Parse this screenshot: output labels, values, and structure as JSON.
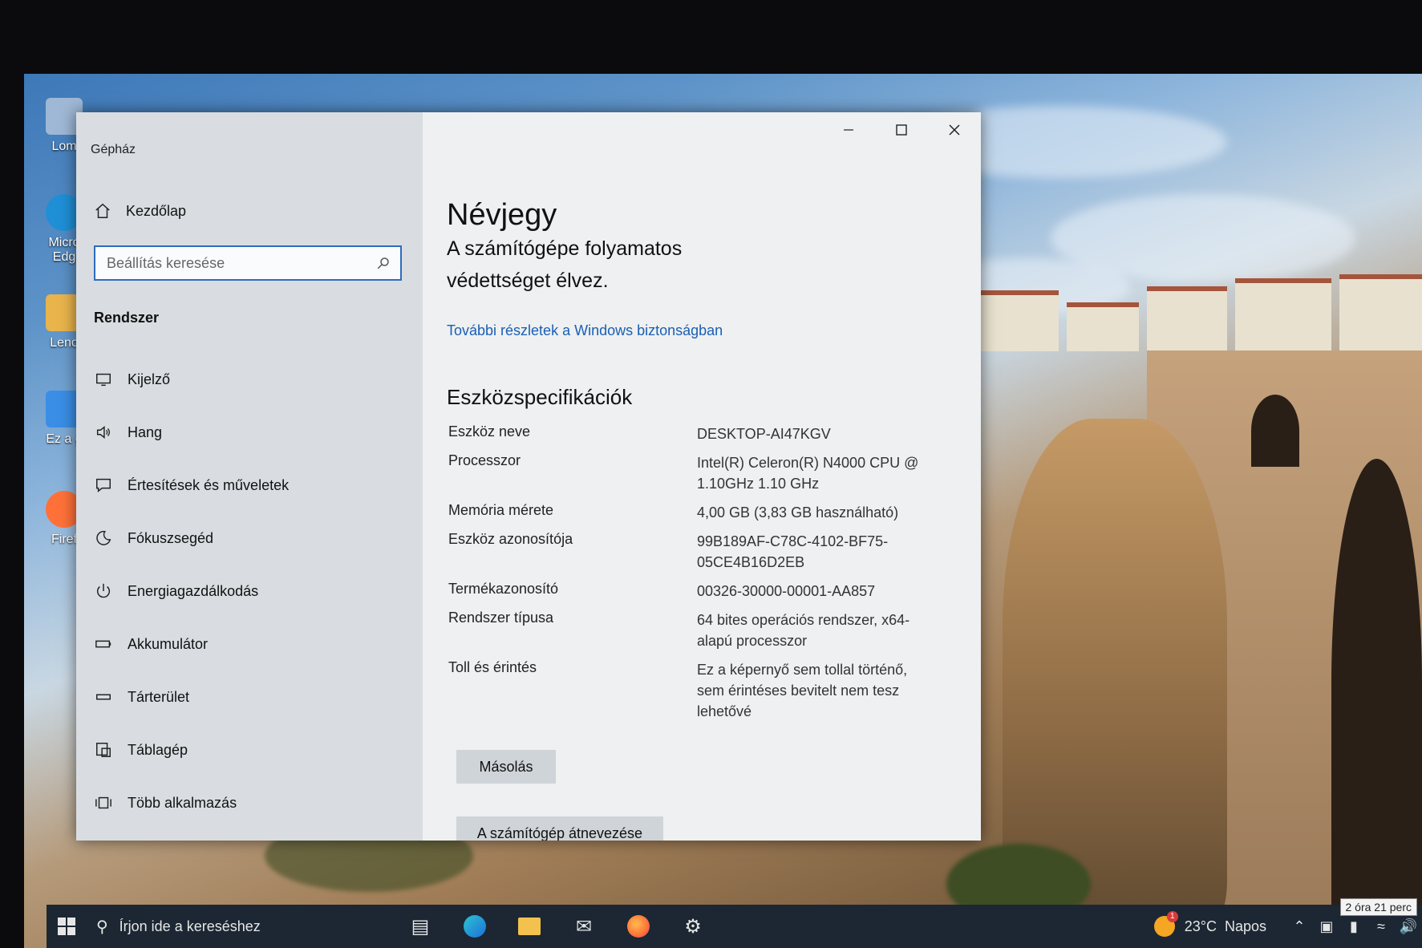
{
  "window": {
    "title": "Gépház"
  },
  "sidebar": {
    "home_label": "Kezdőlap",
    "search_placeholder": "Beállítás keresése",
    "section_title": "Rendszer",
    "items": [
      {
        "label": "Kijelző",
        "icon": "monitor-icon"
      },
      {
        "label": "Hang",
        "icon": "speaker-icon"
      },
      {
        "label": "Értesítések és műveletek",
        "icon": "notification-icon"
      },
      {
        "label": "Fókuszsegéd",
        "icon": "moon-icon"
      },
      {
        "label": "Energiagazdálkodás",
        "icon": "power-icon"
      },
      {
        "label": "Akkumulátor",
        "icon": "battery-icon"
      },
      {
        "label": "Tárterület",
        "icon": "storage-icon"
      },
      {
        "label": "Táblagép",
        "icon": "tablet-icon"
      },
      {
        "label": "Több alkalmazás",
        "icon": "multitask-icon"
      }
    ]
  },
  "content": {
    "page_title": "Névjegy",
    "protection_text": "A számítógépe folyamatos védettséget élvez.",
    "security_link": "További részletek a Windows biztonságban",
    "spec_title": "Eszközspecifikációk",
    "specs": [
      {
        "key": "Eszköz neve",
        "value": "DESKTOP-AI47KGV"
      },
      {
        "key": "Processzor",
        "value": "Intel(R) Celeron(R) N4000 CPU @ 1.10GHz   1.10 GHz"
      },
      {
        "key": "Memória mérete",
        "value": "4,00 GB (3,83 GB használható)"
      },
      {
        "key": "Eszköz azonosítója",
        "value": "99B189AF-C78C-4102-BF75-05CE4B16D2EB"
      },
      {
        "key": "Termékazonosító",
        "value": "00326-30000-00001-AA857"
      },
      {
        "key": "Rendszer típusa",
        "value": "64 bites operációs rendszer, x64-alapú processzor"
      },
      {
        "key": "Toll és érintés",
        "value": "Ez a képernyő sem tollal történő, sem érintéses bevitelt nem tesz lehetővé"
      }
    ],
    "copy_button": "Másolás",
    "rename_button": "A számítógép átnevezése"
  },
  "desktop_icons": [
    {
      "label": "Lom",
      "icon": "recycle-bin-icon",
      "color": "#9fb8d6"
    },
    {
      "label": "Micro Edg",
      "icon": "edge-icon",
      "color": "#1f8fd6"
    },
    {
      "label": "Leno",
      "icon": "folder-icon",
      "color": "#e9b44c"
    },
    {
      "label": "Ez a g",
      "icon": "computer-icon",
      "color": "#3a8ee6"
    },
    {
      "label": "Firef",
      "icon": "firefox-icon",
      "color": "#ff7139"
    }
  ],
  "taskbar": {
    "search_placeholder": "Írjon ide a kereséshez",
    "apps": [
      "task-view-icon",
      "edge-icon",
      "file-explorer-icon",
      "mail-icon",
      "firefox-icon",
      "settings-icon"
    ],
    "weather_temp": "23°C",
    "weather_text": "Napos",
    "weather_badge": "1",
    "tooltip": "2 óra 21 perc"
  }
}
